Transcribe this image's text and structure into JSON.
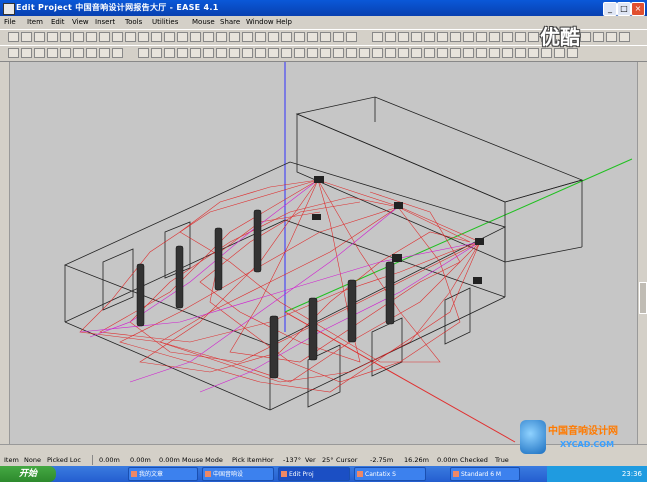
{
  "window": {
    "title": "Edit Project  中国音响设计网报告大厅 - EASE 4.1",
    "buttons": {
      "minimize": "_",
      "maximize": "□",
      "close": "×"
    }
  },
  "menu": [
    "File",
    "Item",
    "Edit",
    "View",
    "Insert",
    "Tools",
    "Utilities",
    "Mouse",
    "Share",
    "Window",
    "Help"
  ],
  "statusbar": {
    "item_label": "Item",
    "none": "None",
    "picked_loc": "Picked Loc",
    "x": "0.00m",
    "y": "0.00m",
    "z": "0.00m",
    "mouse_mode": "Mouse Mode",
    "pick_item": "Pick Item",
    "hor_label": "Hor",
    "hor": "-137°",
    "ver_label": "Ver",
    "ver": "25°",
    "cursor_label": "Cursor",
    "cx": "-2.75m",
    "cy": "16.26m",
    "cz": "0.00m",
    "checked": "Checked",
    "true_val": "True"
  },
  "taskbar": {
    "start": "开始",
    "tasks": [
      "我的文章",
      "中国音响设",
      "Edit Proj",
      "Cantatix S",
      "Standard 6 M"
    ],
    "clock": "23:36"
  },
  "watermarks": {
    "top": "优酷",
    "bottom_cn": "中国音响设计网",
    "bottom_url": "XYCAD.COM"
  },
  "colors": {
    "titlebar": "#0a58d8",
    "rays_red": "#e02020",
    "rays_magenta": "#d020d0",
    "axis_blue": "#3030ff",
    "axis_green": "#20c020",
    "axis_red": "#e03030"
  }
}
